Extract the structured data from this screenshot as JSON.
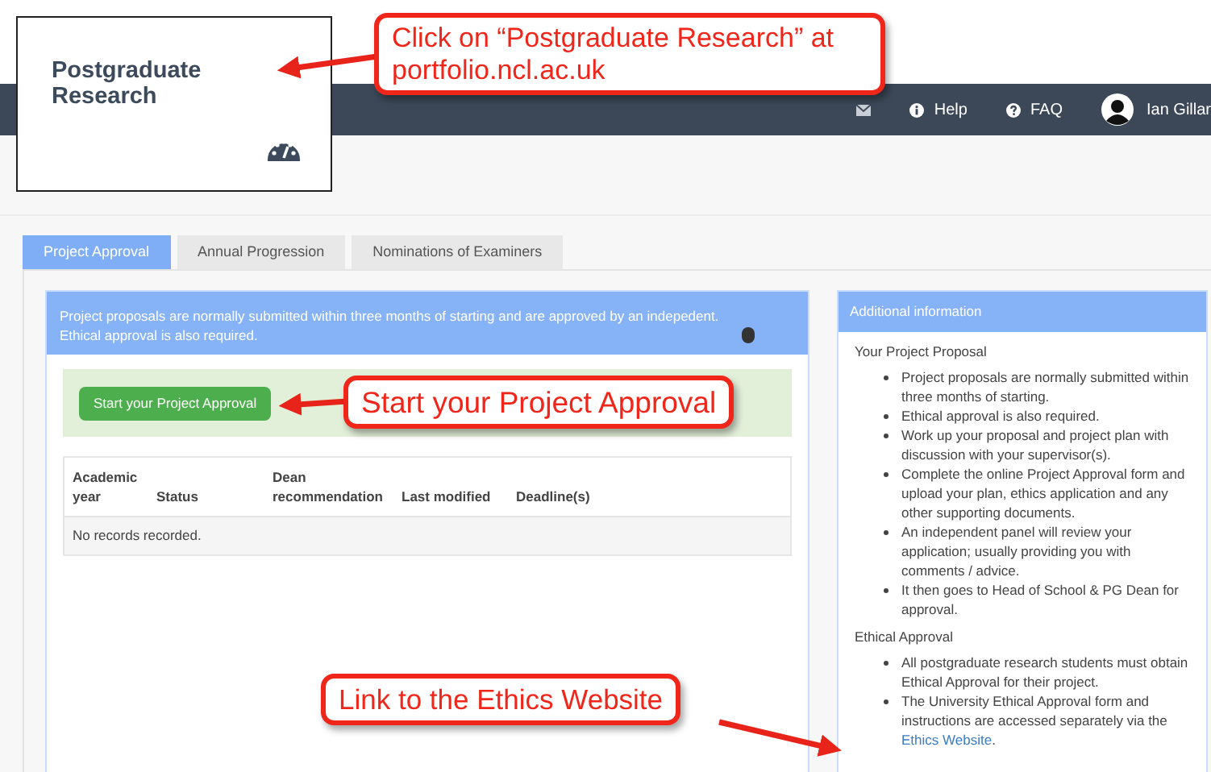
{
  "inset": {
    "title": "Postgraduate Research"
  },
  "navbar": {
    "links": [
      {
        "kind": "info",
        "label": "Help"
      },
      {
        "kind": "question",
        "label": "FAQ"
      }
    ],
    "user_name": "Ian Gillar"
  },
  "tabs": [
    {
      "label": "Project Approval",
      "selected": true
    },
    {
      "label": "Annual Progression",
      "selected": false
    },
    {
      "label": "Nominations of Examiners",
      "selected": false
    }
  ],
  "main_panel": {
    "intro": "Project proposals are normally submitted within three months of starting and are approved by an indepedent. Ethical approval is also required.",
    "start_button": "Start your Project Approval",
    "table": {
      "columns": [
        "Academic year",
        "Status",
        "Dean recommendation",
        "Last modified",
        "Deadline(s)"
      ],
      "empty_message": "No records recorded."
    }
  },
  "info_panel": {
    "title": "Additional information",
    "sections": [
      {
        "heading": "Your Project Proposal",
        "items": [
          {
            "text": "Project proposals are normally submitted within three months of starting."
          },
          {
            "text": "Ethical approval is also required."
          },
          {
            "text": "Work up your proposal and project plan with discussion with your supervisor(s)."
          },
          {
            "text": "Complete the online Project Approval form and upload your plan, ethics application and any other supporting documents."
          },
          {
            "text": "An independent panel will review your application; usually providing you with comments / advice."
          },
          {
            "text": "It then goes to Head of School & PG Dean for approval."
          }
        ]
      },
      {
        "heading": "Ethical Approval",
        "items": [
          {
            "text": "All postgraduate research students must obtain Ethical Approval for their project."
          },
          {
            "text": "The University Ethical Approval form and instructions are accessed separately via the ",
            "link": "Ethics Website",
            "after": "."
          }
        ]
      }
    ]
  },
  "annotations": [
    {
      "text": "Click on “Postgraduate Research” at portfolio.ncl.ac.uk"
    },
    {
      "text": "Start your Project Approval"
    },
    {
      "text": "Link to the Ethics Website"
    }
  ]
}
